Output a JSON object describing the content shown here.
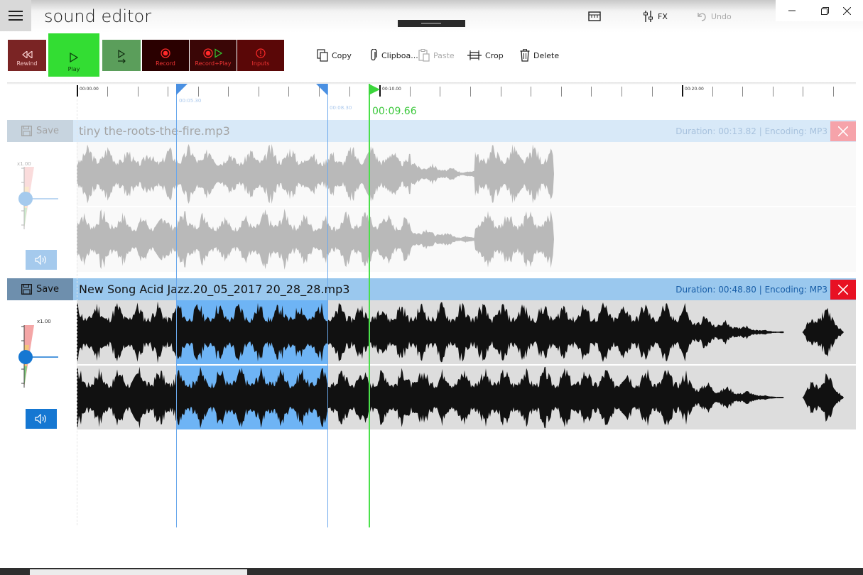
{
  "app": {
    "title": "sound editor"
  },
  "top_actions": {
    "fx_label": "FX",
    "undo_label": "Undo"
  },
  "transport": {
    "rewind_label": "Rewind",
    "play_label": "Play",
    "record_label": "Record",
    "record_play_label": "Record+Play",
    "inputs_label": "Inputs"
  },
  "edit_toolbar": {
    "copy_label": "Copy",
    "clipboard_label": "Clipboa...",
    "paste_label": "Paste",
    "crop_label": "Crop",
    "delete_label": "Delete"
  },
  "ruler": {
    "labels": [
      "00:00.00",
      "00:10.00",
      "00:20.00"
    ],
    "selection_start_label": "00:05.30",
    "selection_end_label": "00:08.30",
    "playhead_label": "00:09.66"
  },
  "tracks": [
    {
      "save_label": "Save",
      "name": "tiny the-roots-the-fire.mp3",
      "duration_prefix": "Duration:",
      "duration": "00:13.82",
      "encoding_prefix": "| Encoding:",
      "encoding": "MP3",
      "volume_label": "x1.00",
      "state": "inactive"
    },
    {
      "save_label": "Save",
      "name": "New Song Acid Jazz.20_05_2017 20_28_28.mp3",
      "duration_prefix": "Duration:",
      "duration": "00:48.80",
      "encoding_prefix": "| Encoding:",
      "encoding": "MP3",
      "volume_label": "x1.00",
      "state": "active"
    }
  ],
  "colors": {
    "play_green": "#33dd33",
    "rewind_red": "#7a2424",
    "record_dark": "#2a0000",
    "selection_blue": "#6eb4f5",
    "accent_blue": "#1577d2",
    "playhead_green": "#4be04b",
    "close_red": "#e81123"
  }
}
